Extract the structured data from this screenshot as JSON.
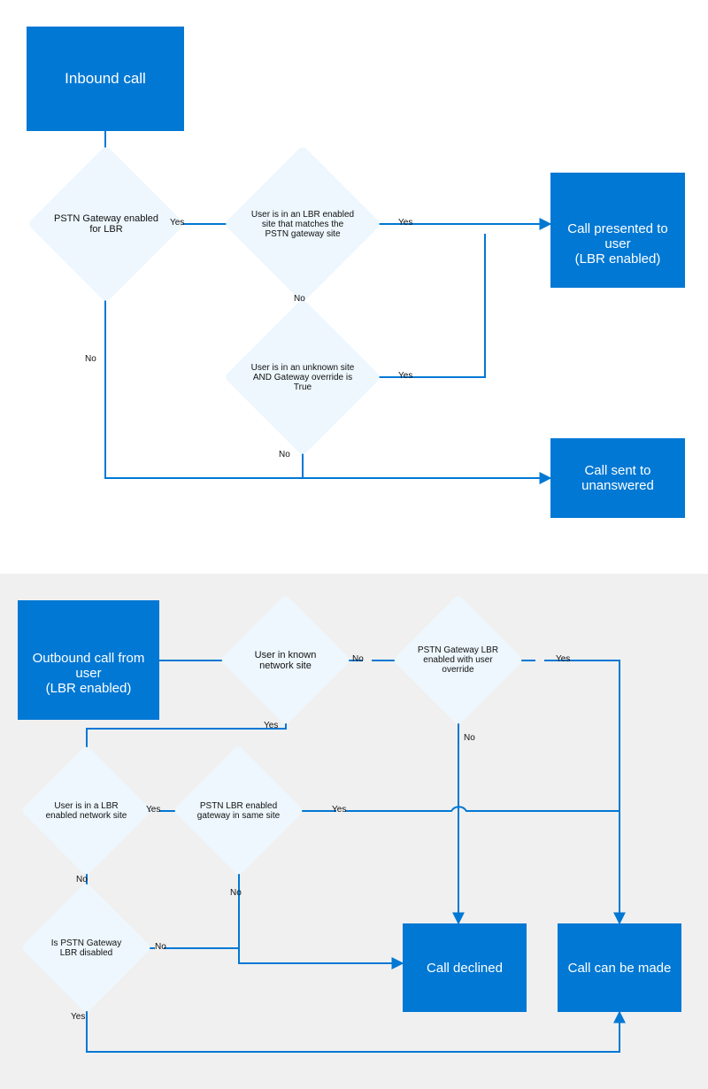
{
  "colors": {
    "brand": "#0078d4",
    "diamond": "#edf7fd"
  },
  "inbound": {
    "start": "Inbound call",
    "d1": "PSTN Gateway enabled for LBR",
    "d2": "User is in an LBR enabled site that matches the PSTN gateway site",
    "d3": "User is in an unknown site AND Gateway override is True",
    "out_presented": "Call presented to user\n(LBR enabled)",
    "out_unanswered": "Call sent to unanswered",
    "yes": "Yes",
    "no": "No"
  },
  "outbound": {
    "start": "Outbound call from user\n(LBR enabled)",
    "d1": "User in known network site",
    "d2": "PSTN Gateway LBR enabled with user override",
    "d3": "User is in a LBR enabled network site",
    "d4": "PSTN LBR enabled gateway in same site",
    "d5": "Is PSTN Gateway LBR disabled",
    "out_declined": "Call declined",
    "out_made": "Call can be made",
    "yes": "Yes",
    "no": "No"
  }
}
